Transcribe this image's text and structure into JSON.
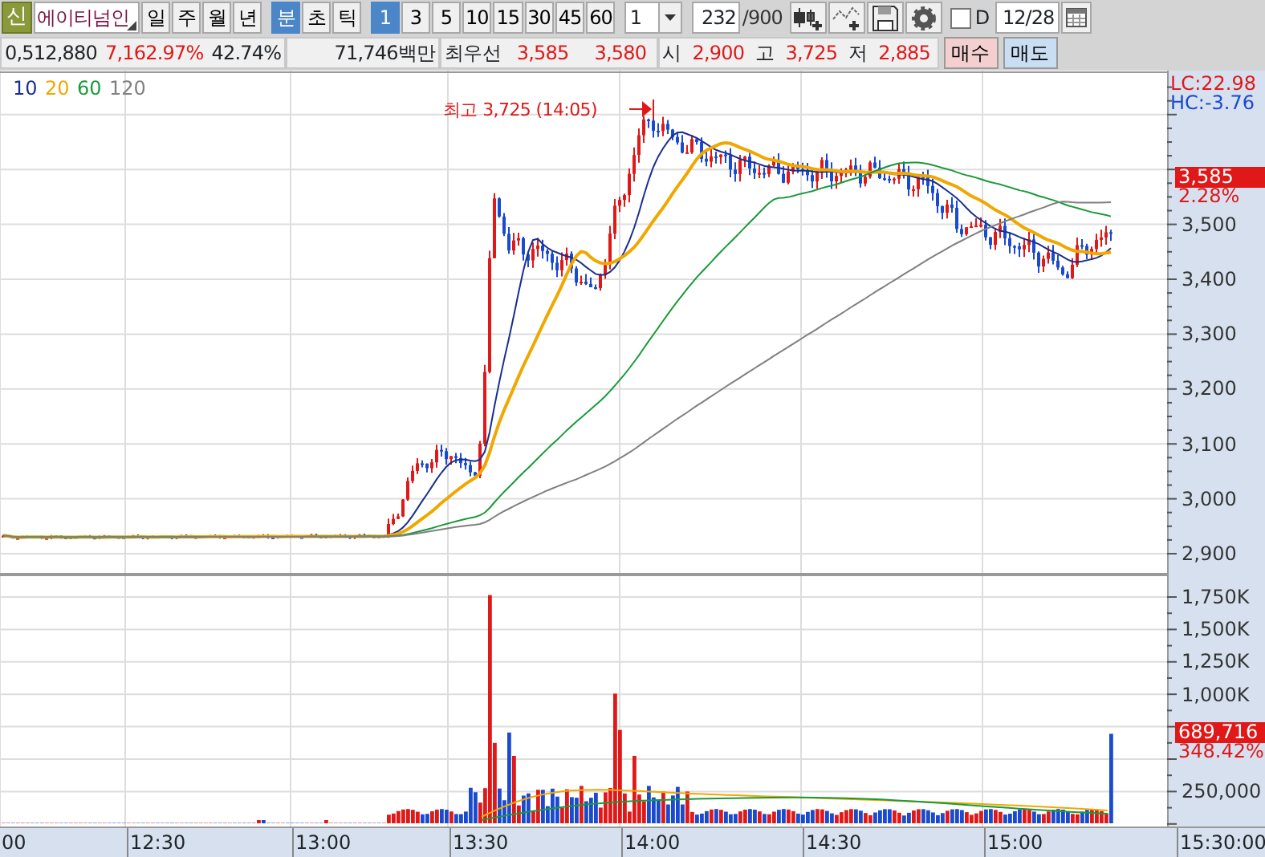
{
  "toolbar": {
    "stock_badge": "신",
    "stock_name": "에이티넘인",
    "periods": [
      {
        "label": "일",
        "selected": false
      },
      {
        "label": "주",
        "selected": false
      },
      {
        "label": "월",
        "selected": false
      },
      {
        "label": "년",
        "selected": false
      }
    ],
    "units": [
      {
        "label": "분",
        "selected": true
      },
      {
        "label": "초",
        "selected": false
      },
      {
        "label": "틱",
        "selected": false
      }
    ],
    "intervals": [
      {
        "label": "1",
        "selected": true
      },
      {
        "label": "3",
        "selected": false
      },
      {
        "label": "5",
        "selected": false
      },
      {
        "label": "10",
        "selected": false
      },
      {
        "label": "15",
        "selected": false
      },
      {
        "label": "30",
        "selected": false
      },
      {
        "label": "45",
        "selected": false
      },
      {
        "label": "60",
        "selected": false
      }
    ],
    "multiplier": "1",
    "bar_count": "232",
    "bar_max": "/900",
    "d_option": {
      "label": "D",
      "checked": false
    },
    "date": "12/28"
  },
  "quote_bar": {
    "volume": "0,512,880",
    "volume_ratio": "7,162.97%",
    "turnover": "42.74%",
    "amount": "71,746백만",
    "best_label": "최우선",
    "ask": "3,585",
    "bid": "3,580",
    "fields": [
      {
        "label": "시",
        "value": "2,900"
      },
      {
        "label": "고",
        "value": "3,725"
      },
      {
        "label": "저",
        "value": "2,885"
      }
    ],
    "buttons": [
      {
        "label": "매수",
        "kind": "buy"
      },
      {
        "label": "매도",
        "kind": "sell"
      }
    ]
  },
  "price_chart": {
    "legend": [
      {
        "label": "10",
        "color": "#1a2f8f"
      },
      {
        "label": "20",
        "color": "#f0a800"
      },
      {
        "label": "60",
        "color": "#1a9a3a"
      },
      {
        "label": "120",
        "color": "#808080"
      }
    ],
    "high_note": "최고 3,725 (14:05)",
    "lc": "LC:22.98",
    "hc": "HC:-3.76",
    "price_tag": "3,585",
    "change_tag": "2.28%",
    "y_labels": [
      "3,500",
      "3,400",
      "3,300",
      "3,200",
      "3,100",
      "3,000",
      "2,900"
    ]
  },
  "volume_chart": {
    "y_labels": [
      "1,750K",
      "1,500K",
      "1,250K",
      "1,000K",
      "250,000"
    ],
    "volume_tag": "689,716",
    "ratio_tag": "348.42%"
  },
  "time_axis": [
    "00",
    "12:30",
    "13:00",
    "13:30",
    "14:00",
    "14:30",
    "15:00",
    "15:30:00"
  ]
}
